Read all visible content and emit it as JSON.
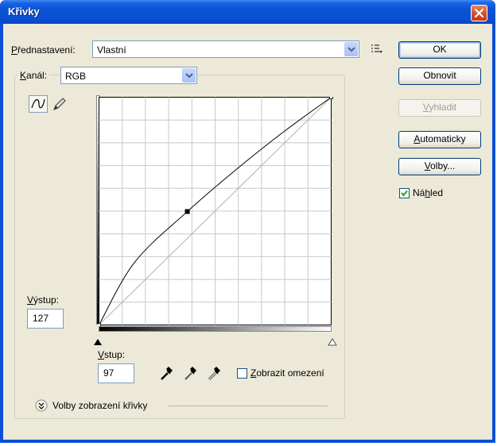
{
  "window": {
    "title": "Křivky"
  },
  "preset": {
    "label_accel": "P",
    "label_rest": "ředn",
    "label_end": "astavení:",
    "value": "Vlastní"
  },
  "channel": {
    "label_accel": "K",
    "label_rest": "anál:",
    "value": "RGB"
  },
  "buttons": {
    "ok": "OK",
    "reset": "Obnovit",
    "smooth_accel": "V",
    "smooth_rest": "yhladit",
    "auto_accel": "A",
    "auto_rest": "utomaticky",
    "options_accel": "V",
    "options_rest": "olby..."
  },
  "preview": {
    "label_pre": "Ná",
    "label_accel": "h",
    "label_post": "led",
    "checked": true
  },
  "output": {
    "label_accel": "V",
    "label_rest": "ýstup:",
    "value": "127"
  },
  "input": {
    "label_accel": "V",
    "label_rest": "stup:",
    "value": "97"
  },
  "clipping": {
    "label_accel": "Z",
    "label_rest": "obrazit omezení",
    "checked": false
  },
  "display_options": {
    "label": "Volby zobrazení křivky"
  },
  "icons": [
    "close-icon",
    "dropdown-arrow-icon",
    "preset-menu-icon",
    "curve-tool-icon",
    "pencil-tool-icon",
    "black-eyedropper-icon",
    "gray-eyedropper-icon",
    "white-eyedropper-icon",
    "expand-chevron-icon",
    "checkmark-icon"
  ],
  "chart_data": {
    "type": "line",
    "xlabel": "Vstup",
    "ylabel": "Výstup",
    "xlim": [
      0,
      255
    ],
    "ylim": [
      0,
      255
    ],
    "grid": true,
    "series": [
      {
        "role": "curve",
        "x": [
          0,
          39,
          97,
          153,
          205,
          255
        ],
        "y": [
          0,
          70,
          127,
          176,
          218,
          255
        ]
      },
      {
        "role": "baseline",
        "x": [
          0,
          255
        ],
        "y": [
          0,
          255
        ]
      }
    ],
    "control_point": {
      "x": 97,
      "y": 127
    }
  }
}
